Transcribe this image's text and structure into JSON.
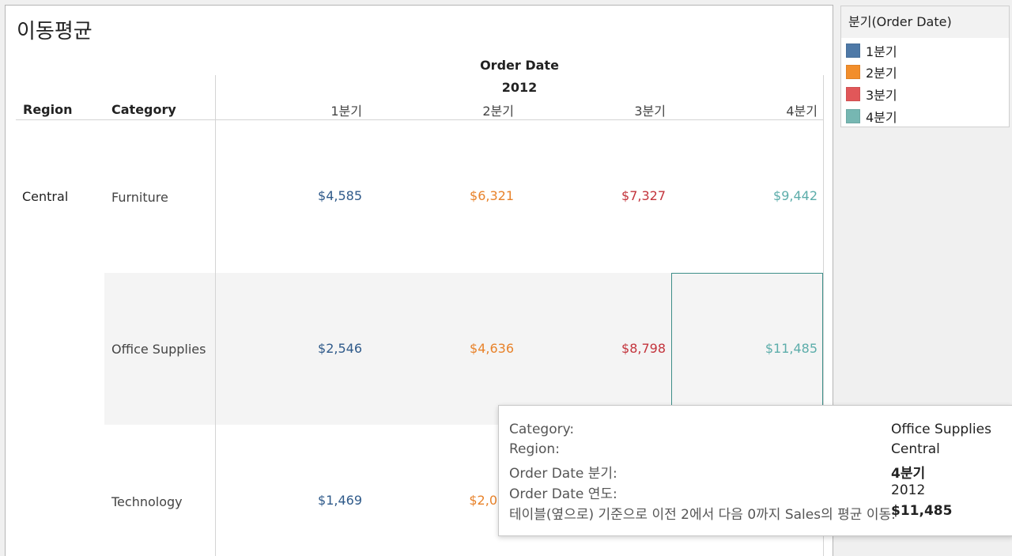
{
  "sheet": {
    "title": "이동평균",
    "header": {
      "order_date": "Order Date",
      "year": "2012",
      "region": "Region",
      "category": "Category"
    },
    "quarters": [
      "1분기",
      "2분기",
      "3분기",
      "4분기"
    ],
    "region": "Central",
    "rows": [
      {
        "category": "Furniture",
        "values": [
          "$4,585",
          "$6,321",
          "$7,327",
          "$9,442"
        ]
      },
      {
        "category": "Office Supplies",
        "values": [
          "$2,546",
          "$4,636",
          "$8,798",
          "$11,485"
        ]
      },
      {
        "category": "Technology",
        "values": [
          "$1,469",
          "$2,0",
          "",
          ""
        ]
      }
    ]
  },
  "legend": {
    "title": "분기(Order Date)",
    "items": [
      {
        "label": "1분기",
        "color": "#4e79a7"
      },
      {
        "label": "2분기",
        "color": "#f28e2b"
      },
      {
        "label": "3분기",
        "color": "#e15759"
      },
      {
        "label": "4분기",
        "color": "#76b7b2"
      }
    ]
  },
  "tooltip": {
    "rows": [
      {
        "key": "Category:",
        "value": "Office Supplies"
      },
      {
        "key": "Region:",
        "value": "Central"
      },
      {
        "key": "Order Date 분기:",
        "value": "4분기",
        "bold": true
      },
      {
        "key": "Order Date 연도:",
        "value": "2012"
      },
      {
        "key": "테이블(옆으로) 기준으로 이전 2에서 다음 0까지 Sales의 평균 이동:",
        "value": "$11,485",
        "bold": true
      }
    ]
  }
}
